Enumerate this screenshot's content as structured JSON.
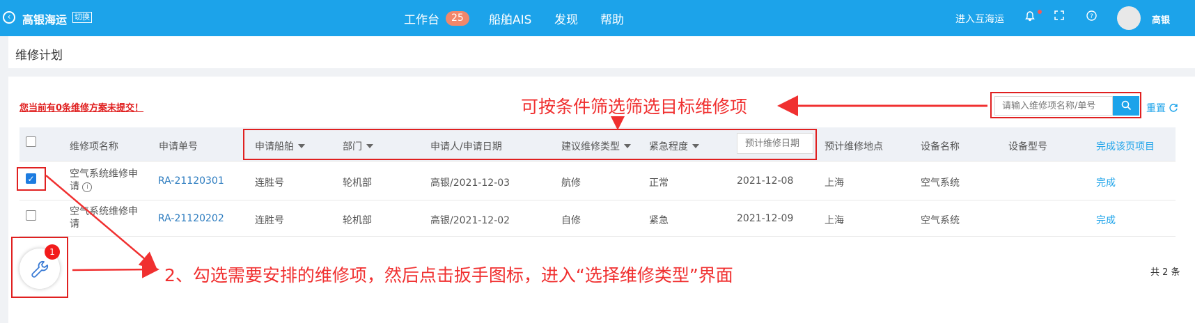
{
  "header": {
    "company": "高银海运",
    "switch_label": "切换",
    "nav": [
      {
        "label": "工作台"
      },
      {
        "label": "船舶AIS"
      },
      {
        "label": "发现"
      },
      {
        "label": "帮助"
      }
    ],
    "workbench_badge": "25",
    "enter_link": "进入互海运",
    "username": "高银",
    "icons": [
      "back-icon",
      "bell-icon",
      "fullscreen-icon",
      "help-icon"
    ]
  },
  "page_title": "维修计划",
  "warning": "您当前有0条维修方案未提交！",
  "annotations": {
    "filter_note": "可按条件筛选筛选目标维修项",
    "wrench_note": "2、勾选需要安排的维修项，然后点击扳手图标，进入“选择维修类型”界面"
  },
  "search": {
    "placeholder": "请输入维修项名称/单号"
  },
  "reset_label": "重置",
  "table": {
    "columns": [
      "维修项名称",
      "申请单号",
      "申请船舶",
      "部门",
      "申请人/申请日期",
      "建议维修类型",
      "紧急程度",
      "预计维修日期",
      "预计维修地点",
      "设备名称",
      "设备型号",
      "完成该页项目"
    ],
    "date_placeholder": "预计维修日期",
    "rows": [
      {
        "name": "空气系统维修申请",
        "no": "RA-21120301",
        "ship": "连胜号",
        "dept": "轮机部",
        "applicant": "高银/2021-12-03",
        "type": "航修",
        "urgency": "正常",
        "date": "2021-12-08",
        "place": "上海",
        "device": "空气系统",
        "model": "",
        "action": "完成",
        "checked": true
      },
      {
        "name": "空气系统维修申请",
        "no": "RA-21120202",
        "ship": "连胜号",
        "dept": "轮机部",
        "applicant": "高银/2021-12-02",
        "type": "自修",
        "urgency": "紧急",
        "date": "2021-12-09",
        "place": "上海",
        "device": "空气系统",
        "model": "",
        "action": "完成",
        "checked": false
      }
    ]
  },
  "wrench_badge": "1",
  "total": "共 2 条",
  "colors": {
    "topbar": "#1ca3ea",
    "annotation": "#f03030",
    "link": "#2b7bbf"
  }
}
